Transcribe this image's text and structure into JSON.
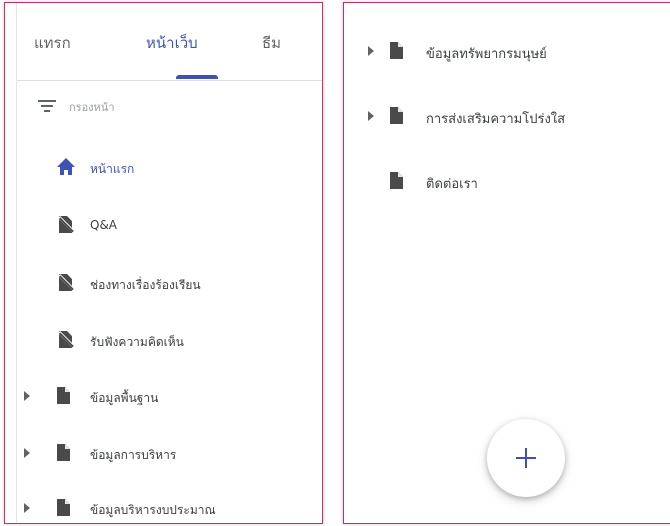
{
  "tabs": [
    {
      "label": "แทรก"
    },
    {
      "label": "หน้าเว็บ",
      "active": true
    },
    {
      "label": "ธีม"
    }
  ],
  "filter": {
    "placeholder": "กรองหน้า"
  },
  "left_pages": [
    {
      "label": "หน้าแรก",
      "icon": "home-icon",
      "selected": true
    },
    {
      "label": "Q&A",
      "icon": "hidden-page-icon"
    },
    {
      "label": "ช่องทางเรื่องร้องเรียน",
      "icon": "hidden-page-icon"
    },
    {
      "label": "รับฟังความคิดเห็น",
      "icon": "hidden-page-icon"
    },
    {
      "label": "ข้อมูลพื้นฐาน",
      "icon": "page-icon",
      "expandable": true
    },
    {
      "label": "ข้อมูลการบริหาร",
      "icon": "page-icon",
      "expandable": true
    },
    {
      "label": "ข้อมูลบริหารงบประมาณ",
      "icon": "page-icon",
      "expandable": true
    }
  ],
  "right_pages": [
    {
      "label": "ข้อมูลทรัพยากรมนุษย์",
      "icon": "page-icon",
      "expandable": true
    },
    {
      "label": "การส่งเสริมความโปร่งใส",
      "icon": "page-icon",
      "expandable": true
    },
    {
      "label": "ติดต่อเรา",
      "icon": "page-icon"
    }
  ],
  "fab": {
    "icon": "plus-icon"
  },
  "colors": {
    "accent": "#3f51b5",
    "panel_border": "#c4306a",
    "icon": "#4a4a4a"
  }
}
